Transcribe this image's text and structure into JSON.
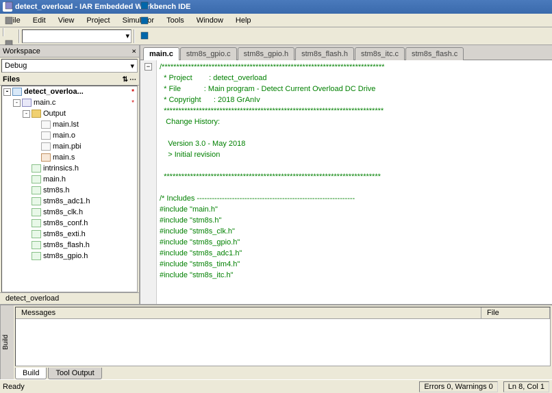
{
  "title": "detect_overload - IAR Embedded Workbench IDE",
  "menus": [
    "File",
    "Edit",
    "View",
    "Project",
    "Simulator",
    "Tools",
    "Window",
    "Help"
  ],
  "workspace": {
    "panel_title": "Workspace",
    "config": "Debug",
    "files_label": "Files",
    "tab": "detect_overload",
    "tree": [
      {
        "d": 0,
        "exp": "-",
        "icon": "proj",
        "label": "detect_overloa...",
        "bold": true,
        "star": true
      },
      {
        "d": 1,
        "exp": "-",
        "icon": "c",
        "label": "main.c",
        "star": true
      },
      {
        "d": 2,
        "exp": "-",
        "icon": "folder",
        "label": "Output"
      },
      {
        "d": 3,
        "exp": "",
        "icon": "txt",
        "label": "main.lst"
      },
      {
        "d": 3,
        "exp": "",
        "icon": "txt",
        "label": "main.o"
      },
      {
        "d": 3,
        "exp": "",
        "icon": "txt",
        "label": "main.pbi"
      },
      {
        "d": 3,
        "exp": "",
        "icon": "asm",
        "label": "main.s"
      },
      {
        "d": 2,
        "exp": "",
        "icon": "h",
        "label": "intrinsics.h"
      },
      {
        "d": 2,
        "exp": "",
        "icon": "h",
        "label": "main.h"
      },
      {
        "d": 2,
        "exp": "",
        "icon": "h",
        "label": "stm8s.h"
      },
      {
        "d": 2,
        "exp": "",
        "icon": "h",
        "label": "stm8s_adc1.h"
      },
      {
        "d": 2,
        "exp": "",
        "icon": "h",
        "label": "stm8s_clk.h"
      },
      {
        "d": 2,
        "exp": "",
        "icon": "h",
        "label": "stm8s_conf.h"
      },
      {
        "d": 2,
        "exp": "",
        "icon": "h",
        "label": "stm8s_exti.h"
      },
      {
        "d": 2,
        "exp": "",
        "icon": "h",
        "label": "stm8s_flash.h"
      },
      {
        "d": 2,
        "exp": "",
        "icon": "h",
        "label": "stm8s_gpio.h"
      }
    ]
  },
  "editor": {
    "tabs": [
      "main.c",
      "stm8s_gpio.c",
      "stm8s_gpio.h",
      "stm8s_flash.h",
      "stm8s_itc.c",
      "stm8s_flash.c"
    ],
    "active_tab": 0,
    "code_html": "<span class='cg'>/****************************************************************************</span>\n<span class='cg'>  * Project        : detect_overload</span>\n<span class='cg'>  * File           : Main program - Detect Current Overload DC Drive</span>\n<span class='cg'>  * Copyright      : 2018 GrAnIv</span>\n<span class='cg'>  ***************************************************************************</span>\n<span class='cg'>   Change History:</span>\n\n<span class='cg'>    Version 3.0 - May 2018</span>\n<span class='cg'>    &gt; Initial revision</span>\n\n<span class='cg'>  **************************************************************************</span>\n\n<span class='cg'>/* Includes ---------------------------------------------------------------</span>\n<span class='cp'>#include </span><span class='cs'>\"main.h\"</span>\n<span class='cp'>#include </span><span class='cs'>\"stm8s.h\"</span>\n<span class='cp'>#include </span><span class='cs'>\"stm8s_clk.h\"</span>\n<span class='cp'>#include </span><span class='cs'>\"stm8s_gpio.h\"</span>\n<span class='cp'>#include </span><span class='cs'>\"stm8s_adc1.h\"</span>\n<span class='cp'>#include </span><span class='cs'>\"stm8s_tim4.h\"</span>\n<span class='cp'>#include </span><span class='cs'>\"stm8s_itc.h\"</span>"
  },
  "build": {
    "side_label": "Build",
    "col_messages": "Messages",
    "col_file": "File",
    "tabs": [
      "Build",
      "Tool Output"
    ],
    "active_tab": 0
  },
  "status": {
    "ready": "Ready",
    "errors": "Errors 0, Warnings 0",
    "pos": "Ln 8, Col 1"
  },
  "toolbar_icons": [
    "new",
    "open",
    "save",
    "saveall",
    "print",
    "",
    "cut",
    "copy",
    "paste",
    "",
    "undo",
    "redo"
  ],
  "toolbar2_icons": [
    "go",
    "check",
    "hammer",
    "wand",
    "stack",
    "box",
    "",
    "play-green",
    "step-over",
    "step-into",
    "step-out",
    "run-to",
    "",
    "stop",
    "reset",
    "mem",
    "watch",
    "",
    "bp",
    "bug",
    "",
    "goto"
  ]
}
